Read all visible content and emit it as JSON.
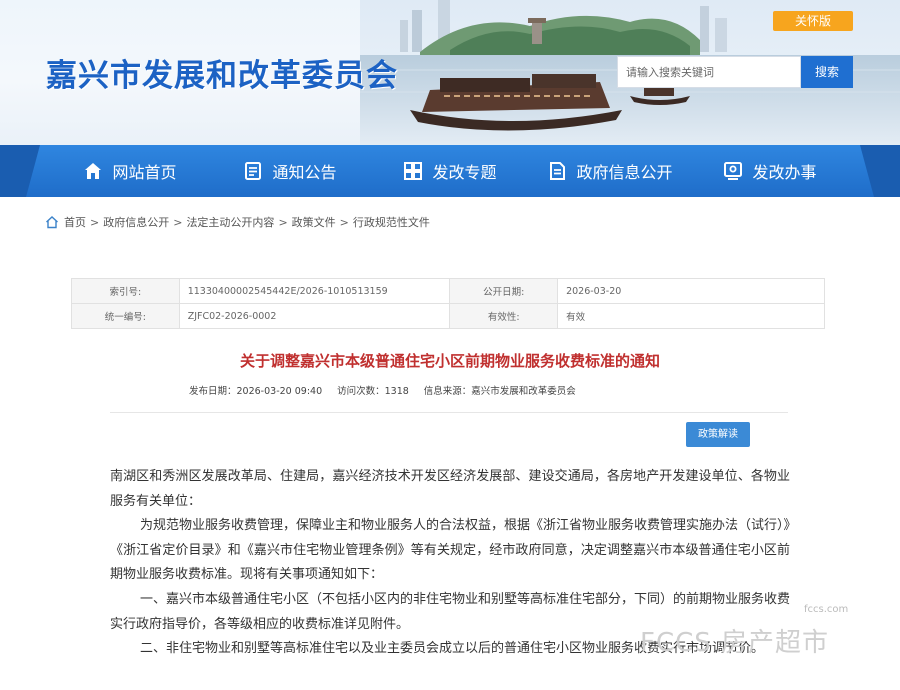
{
  "header": {
    "site_title": "嘉兴市发展和改革委员会",
    "care_mode_label": "关怀版",
    "search_placeholder": "请输入搜索关键词",
    "search_button": "搜索"
  },
  "nav": {
    "items": [
      {
        "label": "网站首页",
        "icon": "home-icon"
      },
      {
        "label": "通知公告",
        "icon": "notice-icon"
      },
      {
        "label": "发改专题",
        "icon": "topics-grid-icon"
      },
      {
        "label": "政府信息公开",
        "icon": "document-icon"
      },
      {
        "label": "发改办事",
        "icon": "service-icon"
      }
    ]
  },
  "breadcrumb": {
    "items": [
      "首页",
      "政府信息公开",
      "法定主动公开内容",
      "政策文件",
      "行政规范性文件"
    ],
    "separator": ">"
  },
  "meta": {
    "index_label": "索引号:",
    "index_value": "11330400002545442E/2026-1010513159",
    "date_label": "公开日期:",
    "date_value": "2026-03-20",
    "serial_label": "统一编号:",
    "serial_value": "ZJFC02-2026-0002",
    "validity_label": "有效性:",
    "validity_value": "有效"
  },
  "article": {
    "title": "关于调整嘉兴市本级普通住宅小区前期物业服务收费标准的通知",
    "publish_date": "发布日期：2026-03-20 09:40",
    "views": "访问次数：1318",
    "source": "信息来源：嘉兴市发展和改革委员会",
    "interpretation_button": "政策解读",
    "paragraphs": [
      "南湖区和秀洲区发展改革局、住建局，嘉兴经济技术开发区经济发展部、建设交通局，各房地产开发建设单位、各物业服务有关单位：",
      "为规范物业服务收费管理，保障业主和物业服务人的合法权益，根据《浙江省物业服务收费管理实施办法（试行）》《浙江省定价目录》和《嘉兴市住宅物业管理条例》等有关规定，经市政府同意，决定调整嘉兴市本级普通住宅小区前期物业服务收费标准。现将有关事项通知如下：",
      "一、嘉兴市本级普通住宅小区（不包括小区内的非住宅物业和别墅等高标准住宅部分，下同）的前期物业服务收费实行政府指导价，各等级相应的收费标准详见附件。",
      "二、非住宅物业和别墅等高标准住宅以及业主委员会成立以后的普通住宅小区物业服务收费实行市场调节价。"
    ]
  },
  "watermark": {
    "domain": "fccs.com",
    "text": "FCCS 房产超市"
  },
  "colors": {
    "brand_blue": "#1c62c4",
    "nav_blue": "#2a7ed8",
    "title_red": "#c0302f",
    "care_orange": "#f7a51e"
  }
}
